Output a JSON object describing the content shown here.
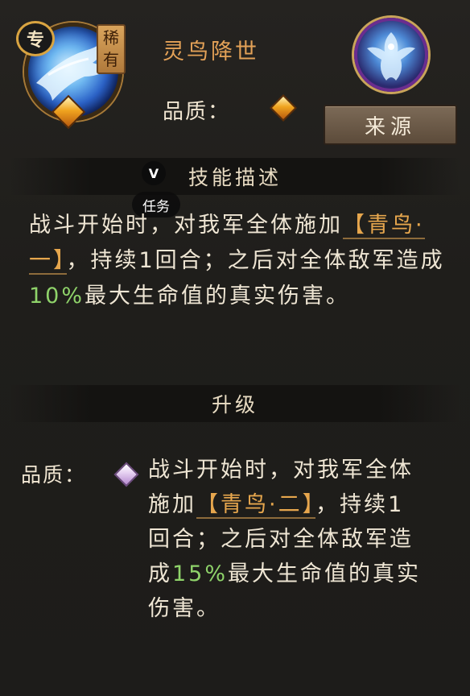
{
  "header": {
    "skill_name": "灵鸟降世",
    "exclusive_badge": "专",
    "rarity_badge": "稀有",
    "quality_label": "品质：",
    "source_button": "来源",
    "colors": {
      "skill_name": "#e3a157",
      "rarity_badge": "#c28a48",
      "quality_gem": "#f0a41f"
    }
  },
  "overlay": {
    "task_icon_letter": "V",
    "task_label": "任务"
  },
  "description": {
    "section_title": "技能描述",
    "text_before": "战斗开始时，对我军全体施加",
    "status_name": "【青鸟·一】",
    "text_middle": "，持续1回合；之后对全体敌军造成",
    "percent": "10%",
    "text_after": "最大生命值的真实伤害。",
    "colors": {
      "status_name": "#e6a64d",
      "percent": "#8fd36a"
    }
  },
  "upgrade": {
    "section_title": "升级",
    "quality_label": "品质：",
    "text_before": "战斗开始时，对我军全体施加",
    "status_name": "【青鸟·二】",
    "text_middle": "，持续1回合；之后对全体敌军造成",
    "percent": "15%",
    "text_after": "最大生命值的真实伤害。",
    "gem_color": "#e7d3f2"
  }
}
